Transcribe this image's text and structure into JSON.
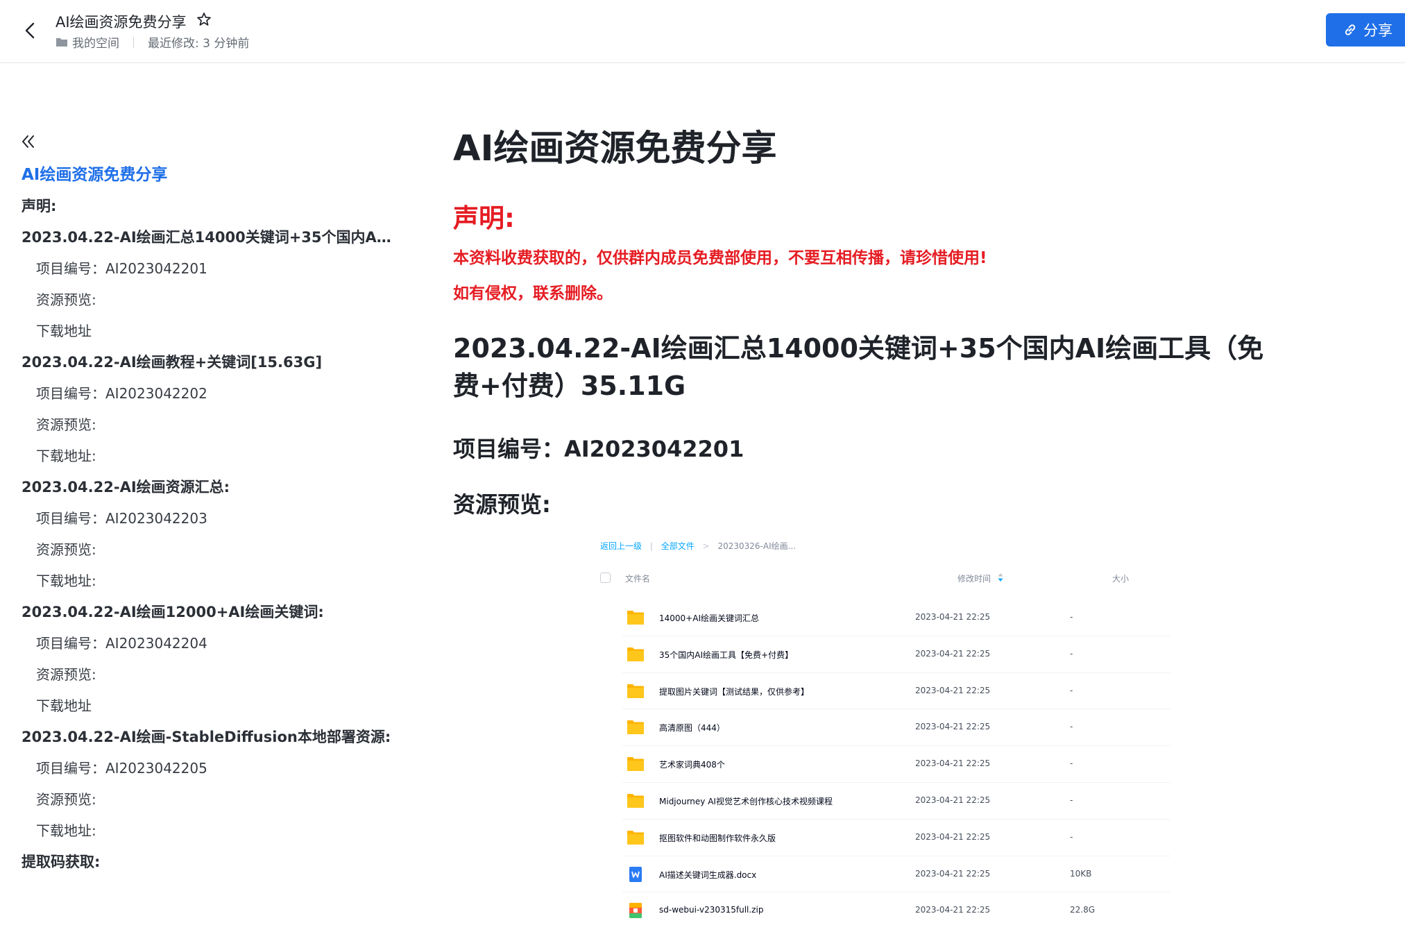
{
  "header": {
    "title": "AI绘画资源免费分享",
    "location": "我的空间",
    "last_modified": "最近修改: 3 分钟前",
    "share_label": "分享"
  },
  "toc": {
    "items": [
      {
        "label": "AI绘画资源免费分享",
        "level": 0
      },
      {
        "label": "声明:",
        "level": 1
      },
      {
        "label": "2023.04.22-AI绘画汇总14000关键词+35个国内AI...",
        "level": 1
      },
      {
        "label": "项目编号：AI2023042201",
        "level": 2
      },
      {
        "label": "资源预览:",
        "level": 2
      },
      {
        "label": "下载地址",
        "level": 2
      },
      {
        "label": "2023.04.22-AI绘画教程+关键词[15.63G]",
        "level": 1
      },
      {
        "label": "项目编号：AI2023042202",
        "level": 2
      },
      {
        "label": "资源预览:",
        "level": 2
      },
      {
        "label": "下载地址:",
        "level": 2
      },
      {
        "label": "2023.04.22-AI绘画资源汇总:",
        "level": 1
      },
      {
        "label": "项目编号：AI2023042203",
        "level": 2
      },
      {
        "label": "资源预览:",
        "level": 2
      },
      {
        "label": "下载地址:",
        "level": 2
      },
      {
        "label": "2023.04.22-AI绘画12000+AI绘画关键词:",
        "level": 1
      },
      {
        "label": "项目编号：AI2023042204",
        "level": 2
      },
      {
        "label": "资源预览:",
        "level": 2
      },
      {
        "label": "下载地址",
        "level": 2
      },
      {
        "label": "2023.04.22-AI绘画-StableDiffusion本地部署资源:",
        "level": 1
      },
      {
        "label": "项目编号：AI2023042205",
        "level": 2
      },
      {
        "label": "资源预览:",
        "level": 2
      },
      {
        "label": "下载地址:",
        "level": 2
      },
      {
        "label": "提取码获取:",
        "level": 1
      }
    ]
  },
  "content": {
    "title": "AI绘画资源免费分享",
    "notice_heading": "声明:",
    "notice_line1": "本资料收费获取的，仅供群内成员免费部使用，不要互相传播，请珍惜使用!",
    "notice_line2": "如有侵权，联系删除。",
    "section_title": "2023.04.22-AI绘画汇总14000关键词+35个国内AI绘画工具（免费+付费）35.11G",
    "project_code": "项目编号：AI2023042201",
    "preview_heading": "资源预览:"
  },
  "preview": {
    "breadcrumb": {
      "back": "返回上一级",
      "root": "全部文件",
      "current": "20230326-AI绘画..."
    },
    "columns": {
      "name": "文件名",
      "time": "修改时间",
      "size": "大小"
    },
    "files": [
      {
        "name": "14000+AI绘画关键词汇总",
        "time": "2023-04-21 22:25",
        "size": "-",
        "icon": "folder-icon"
      },
      {
        "name": "35个国内AI绘画工具【免费+付费】",
        "time": "2023-04-21 22:25",
        "size": "-",
        "icon": "folder-icon"
      },
      {
        "name": "提取图片关键词【测试结果，仅供参考】",
        "time": "2023-04-21 22:25",
        "size": "-",
        "icon": "folder-icon"
      },
      {
        "name": "高清原图（444）",
        "time": "2023-04-21 22:25",
        "size": "-",
        "icon": "folder-icon"
      },
      {
        "name": "艺术家词典408个",
        "time": "2023-04-21 22:25",
        "size": "-",
        "icon": "folder-icon"
      },
      {
        "name": "Midjourney AI视觉艺术创作核心技术视频课程",
        "time": "2023-04-21 22:25",
        "size": "-",
        "icon": "folder-icon"
      },
      {
        "name": "抠图软件和动图制作软件永久版",
        "time": "2023-04-21 22:25",
        "size": "-",
        "icon": "folder-icon"
      },
      {
        "name": "AI描述关键词生成器.docx",
        "time": "2023-04-21 22:25",
        "size": "10KB",
        "icon": "word-doc-icon"
      },
      {
        "name": "sd-webui-v230315full.zip",
        "time": "2023-04-21 22:25",
        "size": "22.8G",
        "icon": "zip-archive-icon"
      }
    ]
  },
  "colors": {
    "accent": "#1f6fe8",
    "notice_red": "#e51c23",
    "folder_yellow": "#ffc61b",
    "link_blue": "#06a7ff"
  }
}
